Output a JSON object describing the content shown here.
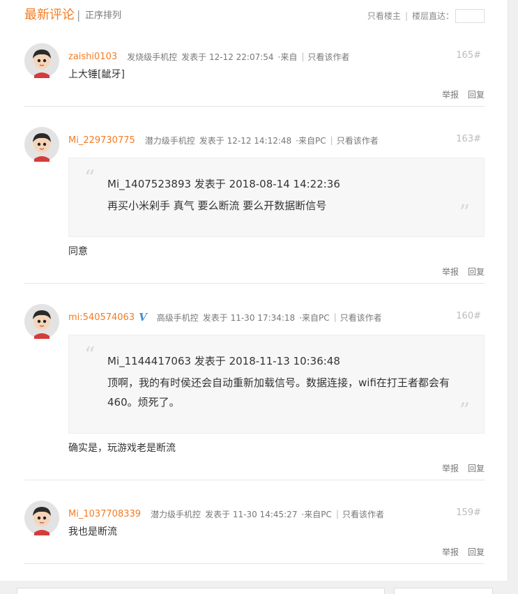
{
  "header": {
    "title": "最新评论",
    "separator": "|",
    "order_label": "正序排列",
    "only_host": "只看楼主",
    "bar": "|",
    "floor_jump": "楼层直达："
  },
  "common": {
    "report": "举报",
    "reply": "回复",
    "only_author": "只看该作者",
    "vbar": "|"
  },
  "comments": [
    {
      "username": "zaishi0103",
      "level": "发烧级手机控",
      "time": "发表于  12-12 22:07:54",
      "source": "·来自",
      "floor": "165#",
      "content": "上大锤[龇牙]"
    },
    {
      "username": "Mi_229730775",
      "level": "潜力级手机控",
      "time": "发表于  12-12 14:12:48",
      "source": "·来自PC",
      "floor": "163#",
      "quote_head": "Mi_1407523893 发表于 2018-08-14 14:22:36",
      "quote_body": "再买小米剁手 真气 要么断流 要么开数据断信号",
      "content": "同意"
    },
    {
      "username": "mi:540574063",
      "badge": "V",
      "level": "高级手机控",
      "time": "发表于  11-30 17:34:18",
      "source": "·来自PC",
      "floor": "160#",
      "quote_head": "Mi_1144417063 发表于 2018-11-13 10:36:48",
      "quote_body": "顶啊，我的有时侯还会自动重新加载信号。数据连接，wifi在打王者都会有460。烦死了。",
      "content": "确实是，玩游戏老是断流"
    },
    {
      "username": "Mi_1037708339",
      "level": "潜力级手机控",
      "time": "发表于  11-30 14:45:27",
      "source": "·来自PC",
      "floor": "159#",
      "content": "我也是断流"
    }
  ],
  "quote_marks": {
    "open": "“",
    "close": "”"
  },
  "colors": {
    "accent": "#f47b22",
    "badge": "#3d8fd6"
  }
}
